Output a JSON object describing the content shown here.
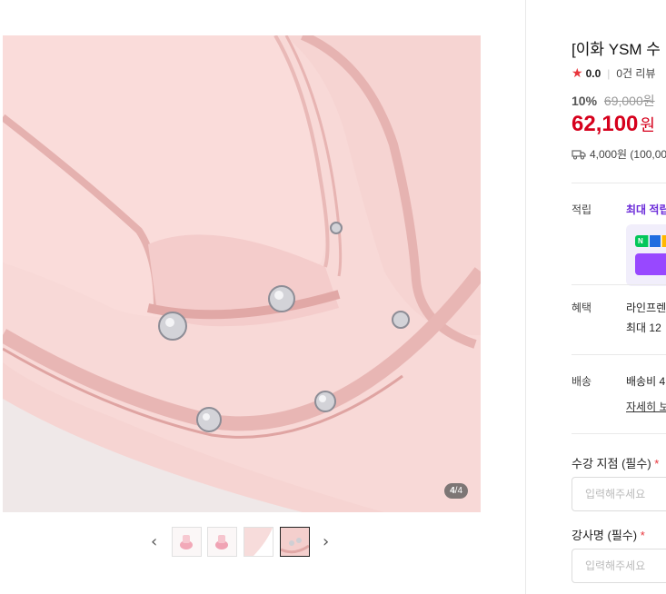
{
  "gallery": {
    "counter_current": "4",
    "counter_sep": "/",
    "counter_total": "4",
    "prev_arrow": "‹",
    "next_arrow": "›"
  },
  "product": {
    "title": "[이화 YSM 수",
    "rating": "0.0",
    "reviews": "0건 리뷰",
    "discount": "10%",
    "original_price": "69,000원",
    "price": "62,100",
    "price_unit": "원",
    "shipping_summary": "4,000원 (100,00"
  },
  "info": {
    "points_label": "적립",
    "points_value": "최대 적립",
    "npay_badge": "N",
    "benefit_label": "혜택",
    "benefit_line1": "라인프렌",
    "benefit_line2": "최대 12",
    "shipping_label": "배송",
    "shipping_value": "배송비 4",
    "shipping_detail": "자세히 보"
  },
  "form": {
    "branch_label": "수강 지점 (필수)",
    "branch_req": "*",
    "branch_placeholder": "입력해주세요",
    "instructor_label": "강사명 (필수)",
    "instructor_req": "*",
    "instructor_placeholder": "입력해주세요"
  },
  "colors": {
    "accent_red": "#d6001c",
    "points_purple": "#6b2bd9",
    "star": "#e8343b"
  }
}
